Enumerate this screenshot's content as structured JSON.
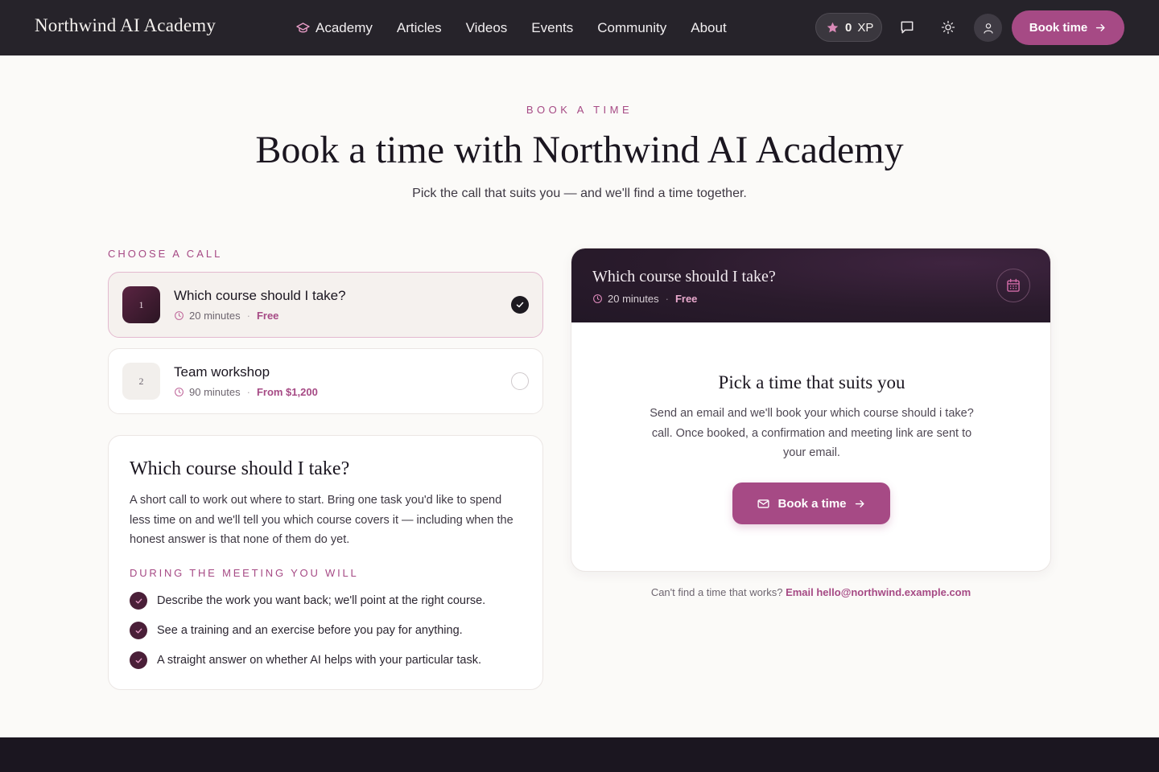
{
  "nav": {
    "brand": "Northwind AI Academy",
    "links": [
      {
        "label": "Academy",
        "icon": "graduation-cap-icon"
      },
      {
        "label": "Articles"
      },
      {
        "label": "Videos"
      },
      {
        "label": "Events"
      },
      {
        "label": "Community"
      },
      {
        "label": "About"
      }
    ],
    "xp_value": "0",
    "xp_unit": "XP",
    "cta_label": "Book time"
  },
  "hero": {
    "eyebrow": "BOOK A TIME",
    "title": "Book a time with Northwind AI Academy",
    "subtitle": "Pick the call that suits you — and we'll find a time together."
  },
  "choose": {
    "label": "CHOOSE A CALL",
    "calls": [
      {
        "number": "1",
        "title": "Which course should I take?",
        "duration": "20 minutes",
        "price": "Free",
        "selected": true
      },
      {
        "number": "2",
        "title": "Team workshop",
        "duration": "90 minutes",
        "price": "From $1,200",
        "selected": false
      }
    ]
  },
  "detail": {
    "title": "Which course should I take?",
    "body": "A short call to work out where to start. Bring one task you'd like to spend less time on and we'll tell you which course covers it — including when the honest answer is that none of them do yet.",
    "during_label": "DURING THE MEETING YOU WILL",
    "bullets": [
      "Describe the work you want back; we'll point at the right course.",
      "See a training and an exercise before you pay for anything.",
      "A straight answer on whether AI helps with your particular task."
    ]
  },
  "booking": {
    "header_title": "Which course should I take?",
    "header_duration": "20 minutes",
    "header_price": "Free",
    "pick_title": "Pick a time that suits you",
    "pick_body": "Send an email and we'll book your which course should i take? call. Once booked, a confirmation and meeting link are sent to your email.",
    "button_label": "Book a time",
    "cant_find": "Can't find a time that works?",
    "email_link": "Email hello@northwind.example.com"
  },
  "colors": {
    "accent": "#a64a85",
    "nav_bg": "#26232a",
    "dark_header": "#2a1b2c",
    "footer_bg": "#1b1620"
  }
}
